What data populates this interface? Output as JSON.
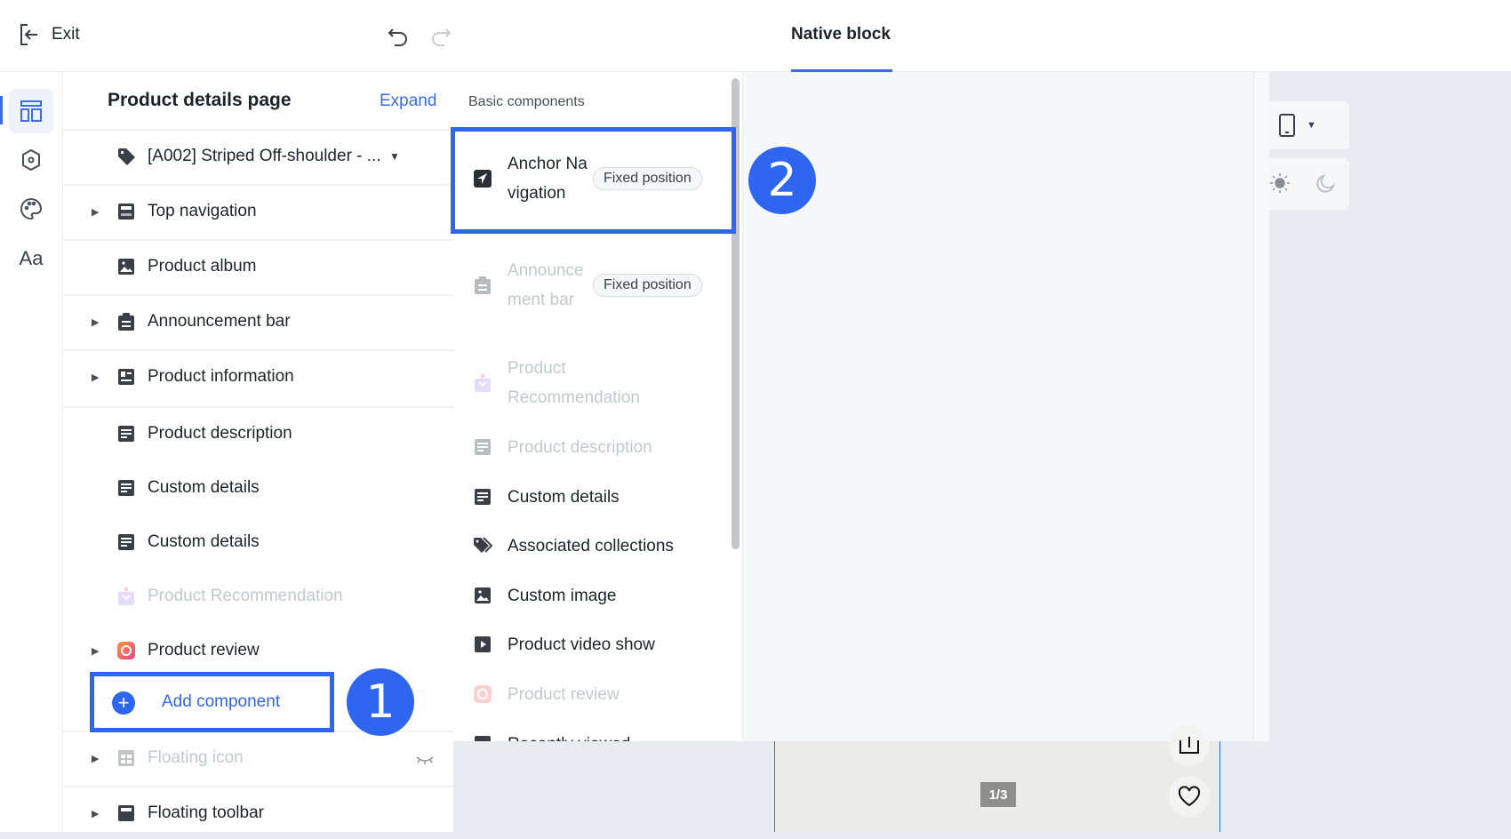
{
  "header": {
    "exit_label": "Exit"
  },
  "left_panel": {
    "title": "Product details page",
    "expand_label": "Expand",
    "product_selector": "[A002] Striped Off-shoulder - ...",
    "items": [
      {
        "label": "Top navigation"
      },
      {
        "label": "Product album"
      },
      {
        "label": "Announcement bar"
      },
      {
        "label": "Product information"
      },
      {
        "label": "Product description"
      },
      {
        "label": "Custom details"
      },
      {
        "label": "Custom details"
      },
      {
        "label": "Product Recommendation"
      },
      {
        "label": "Product review"
      },
      {
        "label": "Floating icon"
      },
      {
        "label": "Floating toolbar"
      }
    ],
    "add_component_label": "Add component"
  },
  "components_panel": {
    "tab": "Native block",
    "heading": "Basic components",
    "items": [
      {
        "label": "Anchor Navigation",
        "badge": "Fixed position"
      },
      {
        "label": "Announcement bar",
        "badge": "Fixed position"
      },
      {
        "label": "Product Recommendation"
      },
      {
        "label": "Product description"
      },
      {
        "label": "Custom details"
      },
      {
        "label": "Associated collections"
      },
      {
        "label": "Custom image"
      },
      {
        "label": "Product video show"
      },
      {
        "label": "Product review"
      },
      {
        "label": "Recently viewed"
      }
    ]
  },
  "annotations": {
    "step1": "1",
    "step2": "2"
  },
  "preview": {
    "pager": "1/3"
  },
  "colors": {
    "accent": "#3a6ce6",
    "highlight": "#2f66f0"
  }
}
